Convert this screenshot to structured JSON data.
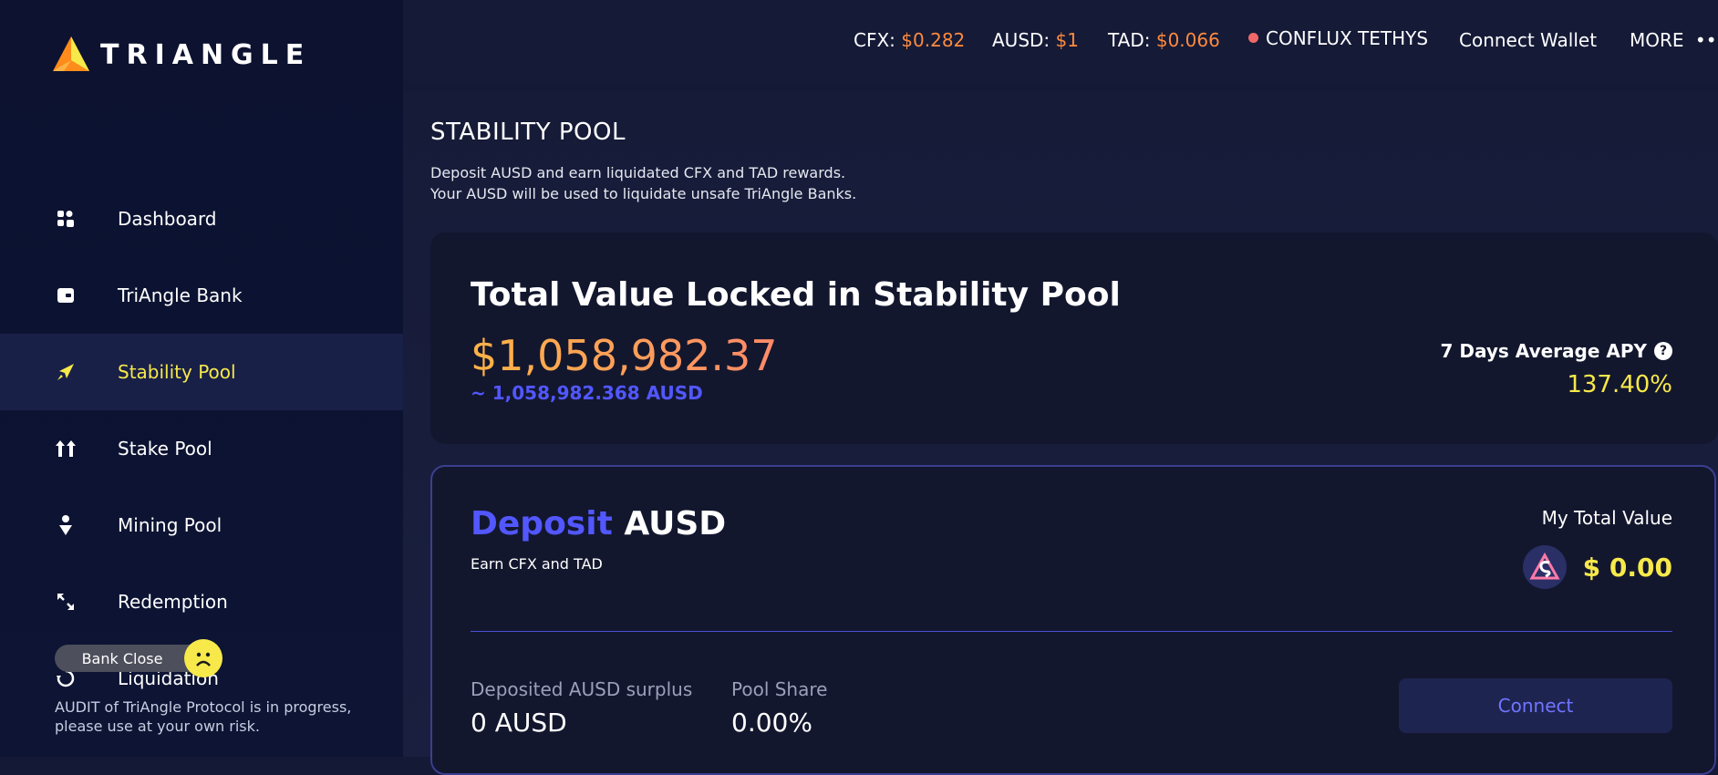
{
  "brand": {
    "name": "TRIANGLE"
  },
  "sidebar": {
    "items": [
      {
        "label": "Dashboard",
        "icon": "dashboard-icon"
      },
      {
        "label": "TriAngle Bank",
        "icon": "bank-icon"
      },
      {
        "label": "Stability Pool",
        "icon": "stability-pool-icon",
        "active": true
      },
      {
        "label": "Stake Pool",
        "icon": "stake-icon"
      },
      {
        "label": "Mining Pool",
        "icon": "mining-icon"
      },
      {
        "label": "Redemption",
        "icon": "redemption-icon"
      },
      {
        "label": "Liquidation",
        "icon": "liquidation-icon"
      }
    ],
    "bank_close_label": "Bank Close",
    "audit_notice": "AUDIT of TriAngle Protocol is in progress, please use at your own risk."
  },
  "topbar": {
    "cfx_label": "CFX:",
    "cfx_price": "$0.282",
    "ausd_label": "AUSD:",
    "ausd_price": "$1",
    "tad_label": "TAD:",
    "tad_price": "$0.066",
    "network": "CONFLUX TETHYS",
    "connect_wallet": "Connect Wallet",
    "more": "MORE"
  },
  "page": {
    "title": "STABILITY POOL",
    "desc_line1": "Deposit AUSD and earn liquidated CFX and TAD rewards.",
    "desc_line2": "Your AUSD will be used to liquidate unsafe TriAngle Banks."
  },
  "tvl": {
    "title": "Total Value Locked in Stability Pool",
    "value": "$1,058,982.37",
    "sub": "~ 1,058,982.368 AUSD",
    "apy_label": "7 Days Average APY",
    "apy_value": "137.40%"
  },
  "deposit": {
    "title_accent": "Deposit",
    "title_rest": "AUSD",
    "subtitle": "Earn CFX and TAD",
    "total_value_label": "My Total Value",
    "total_value": "$ 0.00",
    "surplus_label": "Deposited AUSD surplus",
    "surplus_value": "0 AUSD",
    "share_label": "Pool Share",
    "share_value": "0.00%",
    "connect_label": "Connect"
  },
  "colors": {
    "accent_yellow": "#f7e94a",
    "accent_blue": "#5257ff",
    "price_orange": "#ff8a3d"
  }
}
